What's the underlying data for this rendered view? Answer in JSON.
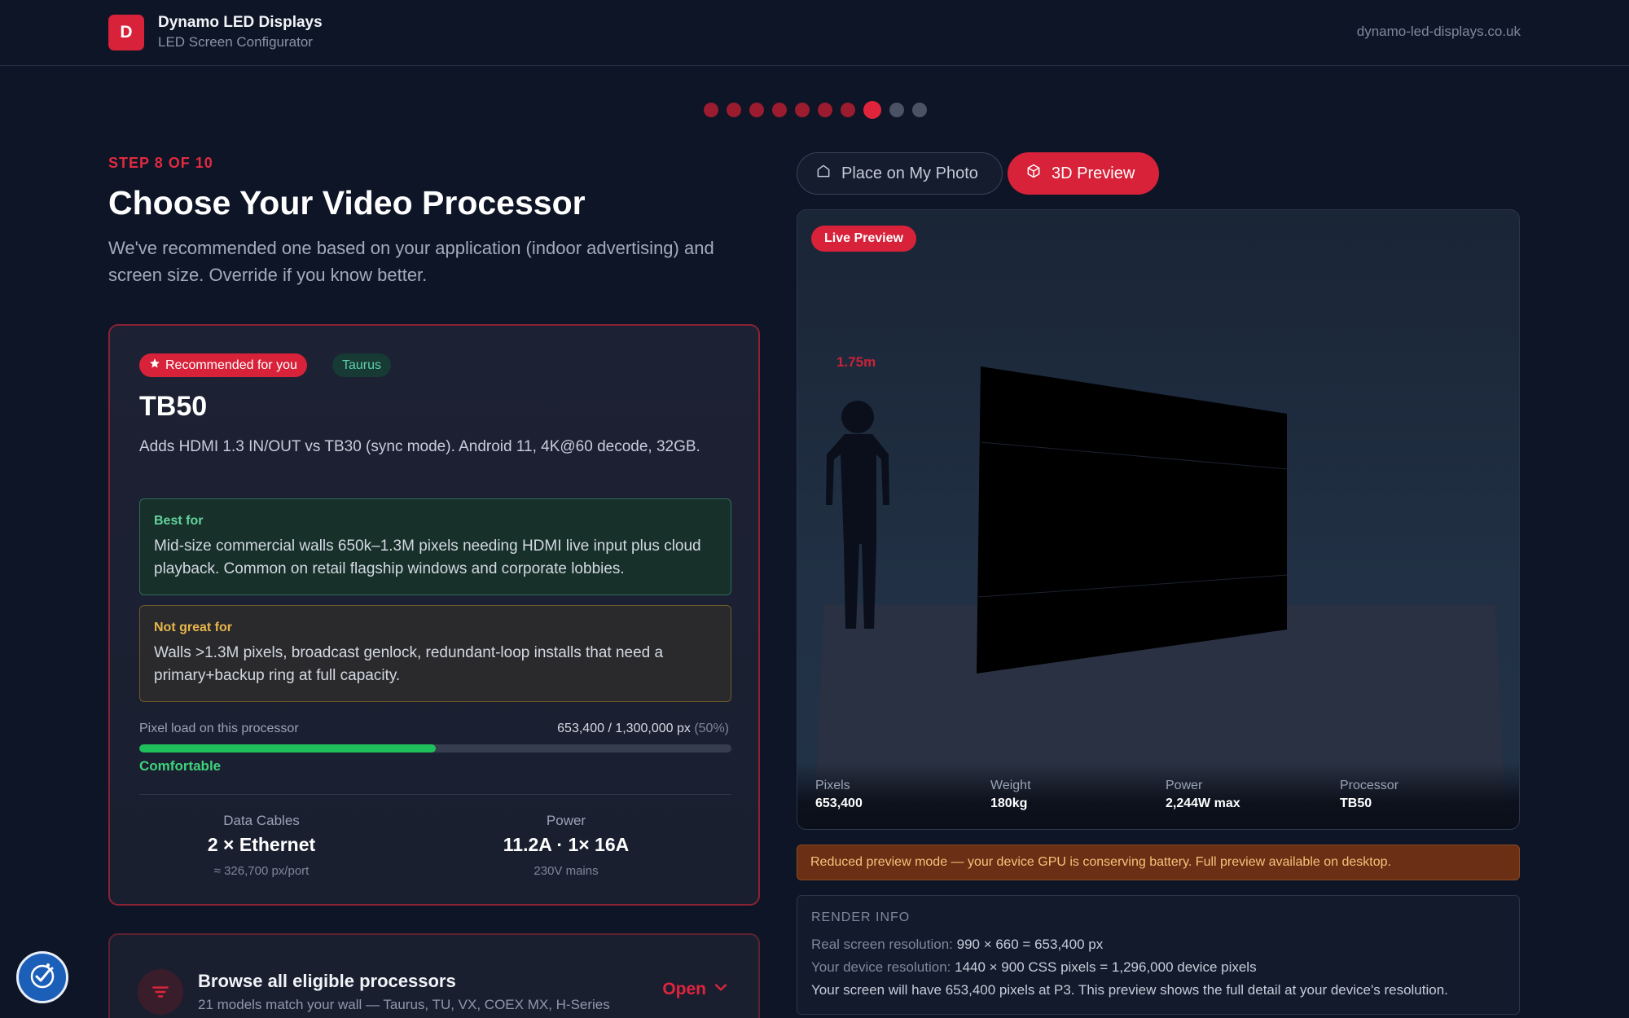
{
  "header": {
    "logo_letter": "D",
    "brand_name": "Dynamo LED Displays",
    "brand_sub": "LED Screen Configurator",
    "site_url": "dynamo-led-displays.co.uk"
  },
  "progress": {
    "total_steps": 10,
    "current_step": 8
  },
  "step": {
    "label": "STEP 8 OF 10",
    "title": "Choose Your Video Processor",
    "description": "We've recommended one based on your application (indoor advertising) and screen size. Override if you know better."
  },
  "recommended": {
    "badge": "Recommended for you",
    "brand_badge": "Taurus",
    "name": "TB50",
    "description": "Adds HDMI 1.3 IN/OUT vs TB30 (sync mode). Android 11, 4K@60 decode, 32GB.",
    "best_for_title": "Best for",
    "best_for_text": "Mid-size commercial walls 650k–1.3M pixels needing HDMI live input plus cloud playback. Common on retail flagship windows and corporate lobbies.",
    "not_great_title": "Not great for",
    "not_great_text": "Walls >1.3M pixels, broadcast genlock, redundant-loop installs that need a primary+backup ring at full capacity.",
    "load_label": "Pixel load on this processor",
    "load_value": "653,400 / 1,300,000 px",
    "load_pct_text": "(50%)",
    "load_fraction": 0.5,
    "load_status": "Comfortable",
    "specs": {
      "cables_label": "Data Cables",
      "cables_value": "2 × Ethernet",
      "cables_sub": "≈ 326,700 px/port",
      "power_label": "Power",
      "power_value": "11.2A · 1× 16A",
      "power_sub": "230V mains"
    }
  },
  "browse": {
    "title": "Browse all eligible processors",
    "subtitle": "21 models match your wall — Taurus, TU, VX, COEX MX, H-Series",
    "open_label": "Open"
  },
  "preview_tabs": {
    "photo_label": "Place on My Photo",
    "preview_label": "3D Preview",
    "active": "3D Preview"
  },
  "preview": {
    "live_badge": "Live Preview",
    "person_height": "1.75m",
    "stats": [
      {
        "label": "Pixels",
        "value": "653,400"
      },
      {
        "label": "Weight",
        "value": "180kg"
      },
      {
        "label": "Power",
        "value": "2,244W max"
      },
      {
        "label": "Processor",
        "value": "TB50"
      }
    ]
  },
  "warning": "Reduced preview mode — your device GPU is conserving battery. Full preview available on desktop.",
  "render_info": {
    "title": "RENDER INFO",
    "line1_label": "Real screen resolution:",
    "line1_value": "990 × 660 = 653,400 px",
    "line2_label": "Your device resolution:",
    "line2_value": "1440 × 900 CSS pixels = 1,296,000 device pixels",
    "line3": "Your screen will have 653,400 pixels at P3. This preview shows the full detail at your device's resolution."
  },
  "colors": {
    "accent": "#d7223a",
    "background": "#0d1526",
    "success": "#1fbf5c",
    "warning_bg": "#6a2f14"
  },
  "icons": {
    "star": "star-icon",
    "photo": "home-outline-icon",
    "cube": "cube-icon",
    "filter": "filter-icon",
    "chevron": "chevron-down-icon",
    "accessibility": "accessibility-icon"
  }
}
